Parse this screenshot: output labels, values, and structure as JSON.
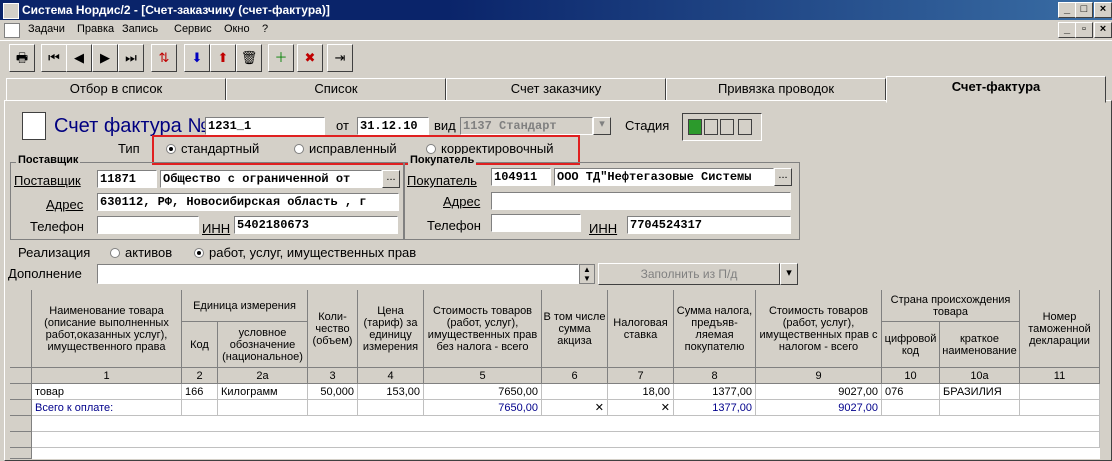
{
  "window": {
    "title": "Система Нордис/2 - [Счет-заказчику (счет-фактура)]"
  },
  "menu": [
    "Задачи",
    "Правка",
    "Запись",
    "Сервис",
    "Окно",
    "?"
  ],
  "tabs": [
    "Отбор в список",
    "Список",
    "Счет заказчику",
    "Привязка проводок",
    "Счет-фактура"
  ],
  "form": {
    "heading": "Счет фактура №",
    "number": "1231_1",
    "date_label": "от",
    "date": "31.12.10",
    "kind_label": "вид",
    "kind": "1137 Стандарт",
    "stage_label": "Стадия",
    "type_label": "Тип",
    "type_options": [
      "стандартный",
      "исправленный",
      "корректировочный"
    ],
    "supplier": {
      "group": "Поставщик",
      "label": "Поставщик",
      "code": "11871",
      "name": "Общество с ограниченной от",
      "address_label": "Адрес",
      "address": "630112, РФ, Новосибирская область , г",
      "phone_label": "Телефон",
      "phone": "",
      "inn_label": "ИНН",
      "inn": "5402180673"
    },
    "buyer": {
      "group": "Покупатель",
      "label": "Покупатель",
      "code": "104911",
      "name": "ООО ТД\"Нефтегазовые Системы",
      "address_label": "Адрес",
      "address": "",
      "phone_label": "Телефон",
      "phone": "",
      "inn_label": "ИНН",
      "inn": "7704524317"
    },
    "realization_label": "Реализация",
    "realization_options": [
      "активов",
      "работ, услуг, имущественных прав"
    ],
    "addition_label": "Дополнение",
    "addition": "",
    "fill_button": "Заполнить из П/д"
  },
  "table": {
    "headers": {
      "name": "Наименование товара (описание выполненных работ,оказанных услуг), имущественного права",
      "unit_group": "Единица измерения",
      "unit_code": "Код",
      "unit_name": "условное обозначение (национальное)",
      "qty": "Коли-чество (объем)",
      "price": "Цена (тариф) за единицу измерения",
      "cost_no_tax": "Стоимость товаров (работ, услуг), имущественных прав без налога - всего",
      "excise": "В том числе сумма акциза",
      "rate": "Налоговая ставка",
      "tax": "Сумма налога, предъяв-ляемая покупателю",
      "cost_tax": "Стоимость товаров (работ, услуг), имущественных прав с налогом - всего",
      "country_group": "Страна происхождения товара",
      "country_code": "цифровой код",
      "country_name": "краткое наименование",
      "declaration": "Номер таможенной декларации"
    },
    "numbers": [
      "1",
      "2",
      "2а",
      "3",
      "4",
      "5",
      "6",
      "7",
      "8",
      "9",
      "10",
      "10а",
      "11"
    ],
    "rows": [
      {
        "name": "товар",
        "code": "166",
        "unit": "Килограмм",
        "qty": "50,000",
        "price": "153,00",
        "cost": "7650,00",
        "excise": "",
        "rate": "18,00",
        "tax": "1377,00",
        "total": "9027,00",
        "ccode": "076",
        "cname": "БРАЗИЛИЯ",
        "decl": ""
      }
    ],
    "total_row": {
      "name": "Всего к оплате:",
      "cost": "7650,00",
      "excise": "✕",
      "rate": "✕",
      "tax": "1377,00",
      "total": "9027,00"
    }
  }
}
